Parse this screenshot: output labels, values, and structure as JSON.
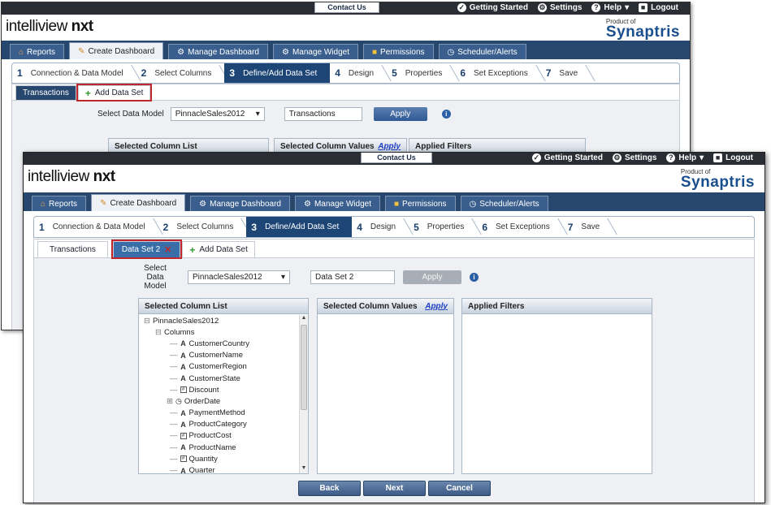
{
  "window_back": {
    "contact_us": "Contact Us",
    "top_links": [
      "Getting Started",
      "Settings",
      "Help",
      "Logout"
    ],
    "logo_main": "intelliview ",
    "logo_bold": "nxt",
    "product_of": "Product of",
    "brand": "Synaptris",
    "nav_tabs": [
      "Reports",
      "Create Dashboard",
      "Manage Dashboard",
      "Manage Widget",
      "Permissions",
      "Scheduler/Alerts"
    ],
    "steps": [
      {
        "num": "1",
        "label": "Connection & Data Model"
      },
      {
        "num": "2",
        "label": "Select Columns"
      },
      {
        "num": "3",
        "label": "Define/Add Data Set"
      },
      {
        "num": "4",
        "label": "Design"
      },
      {
        "num": "5",
        "label": "Properties"
      },
      {
        "num": "6",
        "label": "Set Exceptions"
      },
      {
        "num": "7",
        "label": "Save"
      }
    ],
    "dataset_tabs": [
      "Transactions"
    ],
    "add_dataset": "Add Data Set",
    "select_model_label": "Select Data Model",
    "model_value": "PinnacleSales2012",
    "dataset_name": "Transactions",
    "apply": "Apply",
    "panel_titles": [
      "Selected Column List",
      "Selected Column Values",
      "Applied Filters"
    ],
    "apply_link": "Apply"
  },
  "window_front": {
    "contact_us": "Contact Us",
    "top_links": [
      "Getting Started",
      "Settings",
      "Help",
      "Logout"
    ],
    "logo_main": "intelliview ",
    "logo_bold": "nxt",
    "product_of": "Product of",
    "brand": "Synaptris",
    "nav_tabs": [
      "Reports",
      "Create Dashboard",
      "Manage Dashboard",
      "Manage Widget",
      "Permissions",
      "Scheduler/Alerts"
    ],
    "steps": [
      {
        "num": "1",
        "label": "Connection & Data Model"
      },
      {
        "num": "2",
        "label": "Select Columns"
      },
      {
        "num": "3",
        "label": "Define/Add Data Set"
      },
      {
        "num": "4",
        "label": "Design"
      },
      {
        "num": "5",
        "label": "Properties"
      },
      {
        "num": "6",
        "label": "Set Exceptions"
      },
      {
        "num": "7",
        "label": "Save"
      }
    ],
    "dataset_tabs": [
      "Transactions",
      "Data Set 2"
    ],
    "add_dataset": "Add Data Set",
    "select_model_label_1": "Select Data",
    "select_model_label_2": "Model",
    "model_value": "PinnacleSales2012",
    "dataset_name": "Data Set 2",
    "apply": "Apply",
    "panel_titles": [
      "Selected Column List",
      "Selected Column Values",
      "Applied Filters"
    ],
    "apply_link": "Apply",
    "tree_root": "PinnacleSales2012",
    "tree_group": "Columns",
    "tree_items": [
      {
        "type": "A",
        "name": "CustomerCountry"
      },
      {
        "type": "A",
        "name": "CustomerName"
      },
      {
        "type": "A",
        "name": "CustomerRegion"
      },
      {
        "type": "A",
        "name": "CustomerState"
      },
      {
        "type": "#",
        "name": "Discount"
      },
      {
        "type": "date",
        "name": "OrderDate"
      },
      {
        "type": "A",
        "name": "PaymentMethod"
      },
      {
        "type": "A",
        "name": "ProductCategory"
      },
      {
        "type": "#",
        "name": "ProductCost"
      },
      {
        "type": "A",
        "name": "ProductName"
      },
      {
        "type": "#",
        "name": "Quantity"
      },
      {
        "type": "A",
        "name": "Quarter"
      }
    ],
    "buttons": [
      "Back",
      "Next",
      "Cancel"
    ]
  },
  "colors": {
    "nav": "#27476f",
    "step_active": "#1d4677",
    "highlight": "#c0272d",
    "brand": "#1a4f8f"
  }
}
